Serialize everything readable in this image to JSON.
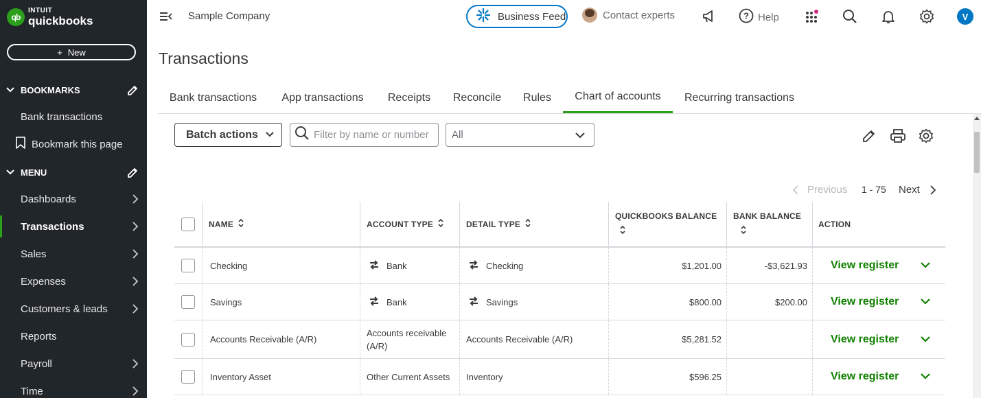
{
  "brand": {
    "intuit": "INTUIT",
    "product": "quickbooks",
    "logo_mark": "qb"
  },
  "sidebar": {
    "new_label": "New",
    "bookmarks_title": "BOOKMARKS",
    "bookmarks": [
      "Bank transactions",
      "Bookmark this page"
    ],
    "menu_title": "MENU",
    "menu": [
      {
        "label": "Dashboards",
        "arrow": true,
        "active": false
      },
      {
        "label": "Transactions",
        "arrow": true,
        "active": true
      },
      {
        "label": "Sales",
        "arrow": true,
        "active": false
      },
      {
        "label": "Expenses",
        "arrow": true,
        "active": false
      },
      {
        "label": "Customers & leads",
        "arrow": true,
        "active": false
      },
      {
        "label": "Reports",
        "arrow": false,
        "active": false
      },
      {
        "label": "Payroll",
        "arrow": true,
        "active": false
      },
      {
        "label": "Time",
        "arrow": true,
        "active": false
      }
    ]
  },
  "topbar": {
    "company": "Sample Company",
    "business_feed": "Business Feed",
    "contact_experts": "Contact experts",
    "help": "Help",
    "user_initial": "V"
  },
  "page": {
    "title": "Transactions",
    "tabs": [
      "Bank transactions",
      "App transactions",
      "Receipts",
      "Reconcile",
      "Rules",
      "Chart of accounts",
      "Recurring transactions"
    ],
    "active_tab": "Chart of accounts"
  },
  "toolbar": {
    "batch_actions": "Batch actions",
    "filter_placeholder": "Filter by name or number",
    "type_select_value": "All"
  },
  "pagination": {
    "previous": "Previous",
    "range": "1 - 75",
    "next": "Next"
  },
  "table": {
    "headers": {
      "name": "NAME",
      "account_type": "ACCOUNT TYPE",
      "detail_type": "DETAIL TYPE",
      "qb_balance": "QUICKBOOKS BALANCE",
      "bank_balance": "BANK BALANCE",
      "action": "ACTION"
    },
    "action_label": "View register",
    "rows": [
      {
        "name": "Checking",
        "account_type": "Bank",
        "detail_type": "Checking",
        "qb_balance": "$1,201.00",
        "bank_balance": "-$3,621.93",
        "bank_icon": true
      },
      {
        "name": "Savings",
        "account_type": "Bank",
        "detail_type": "Savings",
        "qb_balance": "$800.00",
        "bank_balance": "$200.00",
        "bank_icon": true
      },
      {
        "name": "Accounts Receivable (A/R)",
        "account_type": "Accounts receivable (A/R)",
        "detail_type": "Accounts Receivable (A/R)",
        "qb_balance": "$5,281.52",
        "bank_balance": "",
        "bank_icon": false
      },
      {
        "name": "Inventory Asset",
        "account_type": "Other Current Assets",
        "detail_type": "Inventory",
        "qb_balance": "$596.25",
        "bank_balance": "",
        "bank_icon": false
      }
    ]
  },
  "colors": {
    "sidebar_bg": "#21262a",
    "accent_green": "#2ca01c",
    "link_green": "#108000",
    "blue": "#0077c5"
  }
}
